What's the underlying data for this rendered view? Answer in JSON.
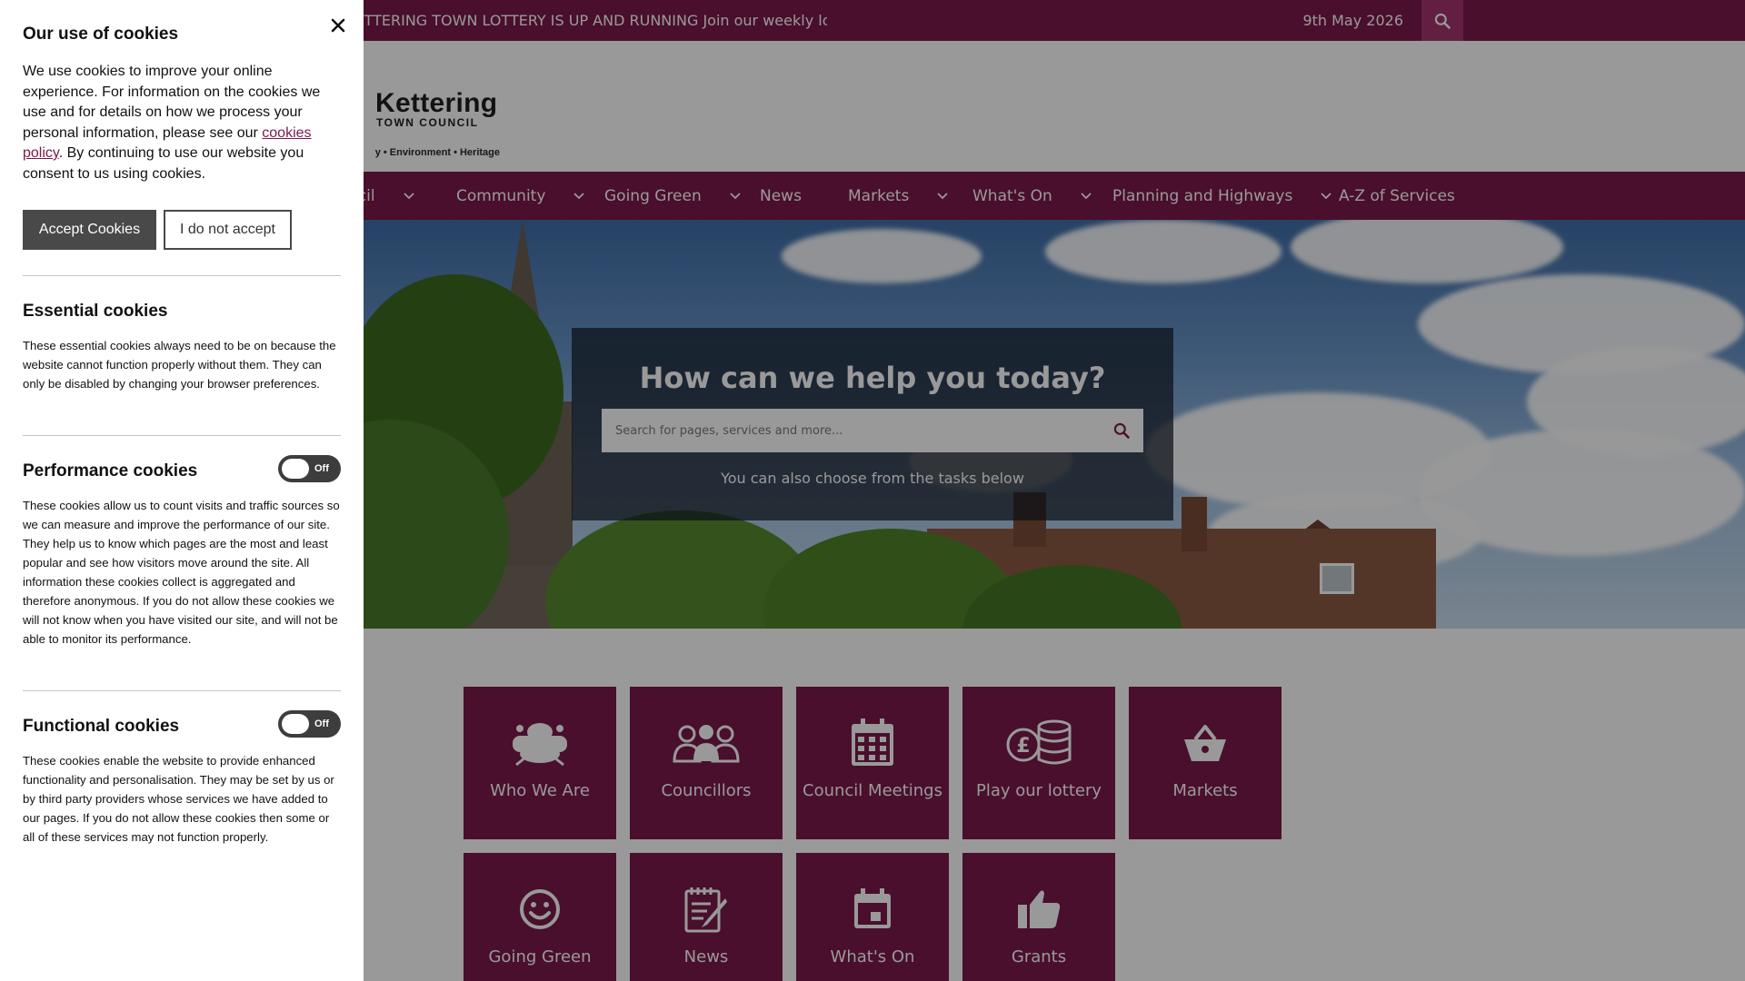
{
  "topbar": {
    "ticker": "KETTERING TOWN LOTTERY IS UP AND RUNNING Join our weekly lotter",
    "date": "9th May 2026"
  },
  "logo": {
    "title": "Kettering",
    "subtitle": "TOWN COUNCIL",
    "tagline": "y • Environment • Heritage"
  },
  "nav": {
    "items": [
      {
        "label": "ncil",
        "dropdown": true
      },
      {
        "label": "Community",
        "dropdown": true
      },
      {
        "label": "Going Green",
        "dropdown": true
      },
      {
        "label": "News",
        "dropdown": false
      },
      {
        "label": "Markets",
        "dropdown": true
      },
      {
        "label": "What's On",
        "dropdown": true
      },
      {
        "label": "Planning and Highways",
        "dropdown": true
      },
      {
        "label": "A-Z of Services",
        "dropdown": false
      }
    ]
  },
  "hero": {
    "title": "How can we help you today?",
    "search_placeholder": "Search for pages, services and more...",
    "subtitle": "You can also choose from the tasks below"
  },
  "tiles": [
    {
      "label": "Who We Are",
      "icon": "town-hall-icon"
    },
    {
      "label": "Councillors",
      "icon": "people-icon"
    },
    {
      "label": "Council Meetings",
      "icon": "calendar-icon"
    },
    {
      "label": "Play our lottery",
      "icon": "coins-icon"
    },
    {
      "label": "Markets",
      "icon": "basket-icon"
    },
    {
      "label": "Going Green",
      "icon": "smiley-icon"
    },
    {
      "label": "News",
      "icon": "notepad-icon"
    },
    {
      "label": "What's On",
      "icon": "event-icon"
    },
    {
      "label": "Grants",
      "icon": "thumbs-up-icon"
    }
  ],
  "cookie": {
    "title": "Our use of cookies",
    "intro_before": "We use cookies to improve your online experience. For information on the cookies we use and for details on how we process your personal information, please see our ",
    "intro_link": "cookies policy",
    "intro_after": ". By continuing to use our website you consent to us using cookies.",
    "accept_label": "Accept Cookies",
    "decline_label": "I do not accept",
    "essential": {
      "heading": "Essential cookies",
      "text": "These essential cookies always need to be on because the website cannot function properly without them. They can only be disabled by changing your browser preferences."
    },
    "performance": {
      "heading": "Performance cookies",
      "toggle": "Off",
      "text": "These cookies allow us to count visits and traffic sources so we can measure and improve the performance of our site. They help us to know which pages are the most and least popular and see how visitors move around the site. All information these cookies collect is aggregated and therefore anonymous. If you do not allow these cookies we will not know when you have visited our site, and will not be able to monitor its performance."
    },
    "functional": {
      "heading": "Functional cookies",
      "toggle": "Off",
      "text": "These cookies enable the website to provide enhanced functionality and personalisation. They may be set by us or by third party providers whose services we have added to our pages. If you do not allow these cookies then some or all of these services may not function properly."
    }
  },
  "colors": {
    "brand": "#7a1a4a",
    "overlay": "#000000"
  }
}
